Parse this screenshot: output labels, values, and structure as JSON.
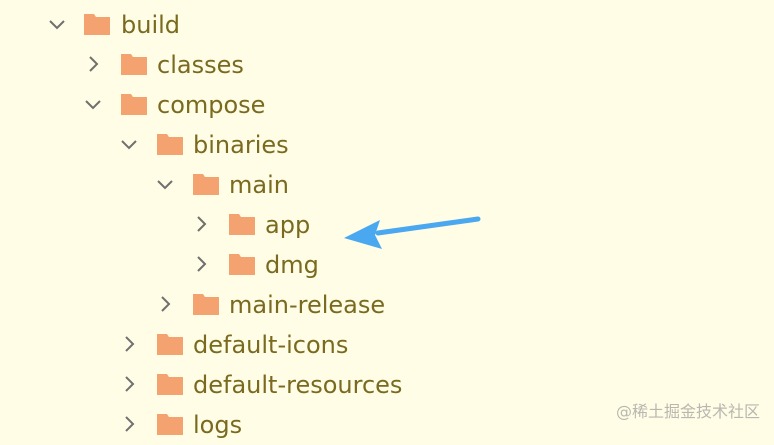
{
  "colors": {
    "background": "#fffde6",
    "label": "#7a6a1f",
    "folder": "#f4a26f",
    "chevron": "#6f6f6f",
    "arrow": "#4aa8f0"
  },
  "tree": {
    "items": [
      {
        "label": "build",
        "expanded": true,
        "chevron": "chevron-down-icon"
      },
      {
        "label": "classes",
        "expanded": false,
        "chevron": "chevron-right-icon"
      },
      {
        "label": "compose",
        "expanded": true,
        "chevron": "chevron-down-icon"
      },
      {
        "label": "binaries",
        "expanded": true,
        "chevron": "chevron-down-icon"
      },
      {
        "label": "main",
        "expanded": true,
        "chevron": "chevron-down-icon"
      },
      {
        "label": "app",
        "expanded": false,
        "chevron": "chevron-right-icon"
      },
      {
        "label": "dmg",
        "expanded": false,
        "chevron": "chevron-right-icon"
      },
      {
        "label": "main-release",
        "expanded": false,
        "chevron": "chevron-right-icon"
      },
      {
        "label": "default-icons",
        "expanded": false,
        "chevron": "chevron-right-icon"
      },
      {
        "label": "default-resources",
        "expanded": false,
        "chevron": "chevron-right-icon"
      },
      {
        "label": "logs",
        "expanded": false,
        "chevron": "chevron-right-icon"
      }
    ]
  },
  "annotation": {
    "icon": "arrow-left-icon",
    "points_to": "app"
  },
  "watermark": "@稀土掘金技术社区"
}
